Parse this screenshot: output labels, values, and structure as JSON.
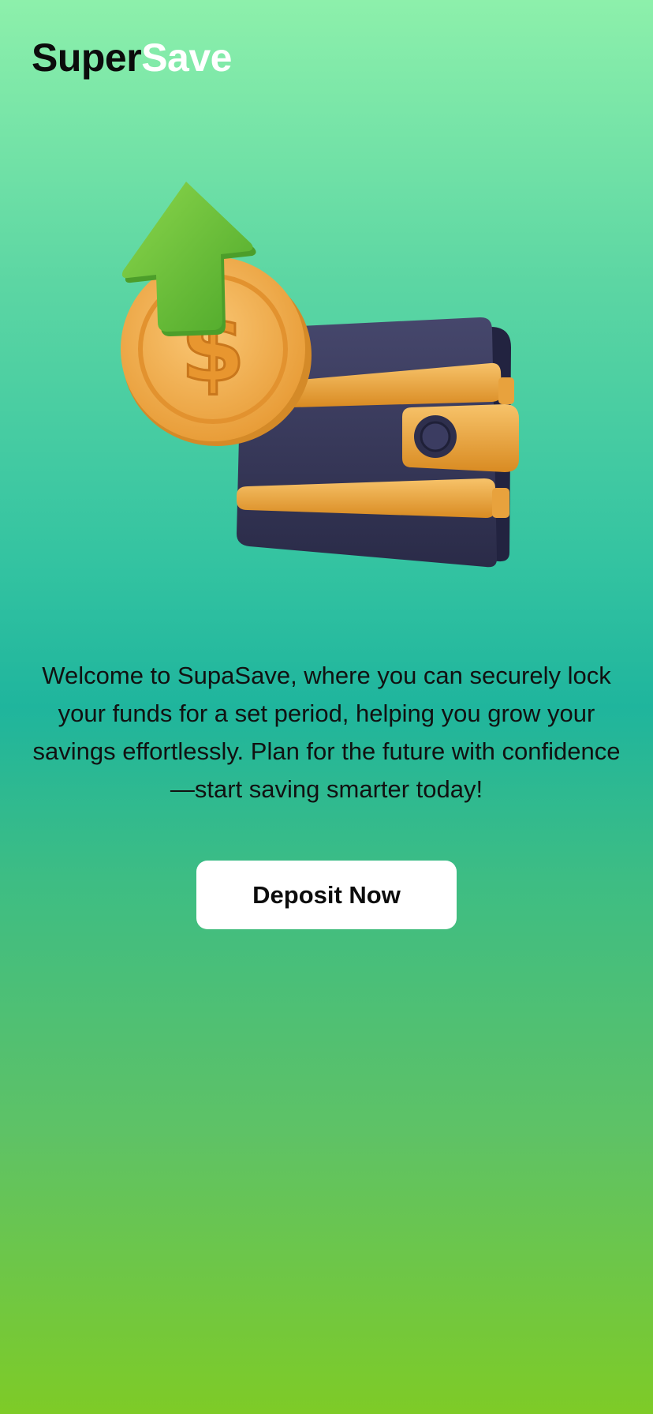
{
  "brand": {
    "name_part1": "Super",
    "name_part2": "Save"
  },
  "hero": {
    "illustration": "wallet-coin-arrow-up-illustration",
    "currency_symbol": "$"
  },
  "welcome": {
    "text": "Welcome to SupaSave, where you can securely lock your funds for a set period, helping you grow your savings effortlessly. Plan for the future with confidence—start saving smarter today!"
  },
  "actions": {
    "deposit_label": "Deposit Now"
  },
  "colors": {
    "gradient_top": "#8df0ab",
    "gradient_mid": "#1fb59d",
    "gradient_bottom": "#7ecb27",
    "button_bg": "#ffffff",
    "wallet": "#3a3b5e",
    "gold": "#f0a93c",
    "arrow": "#6cc23a"
  }
}
